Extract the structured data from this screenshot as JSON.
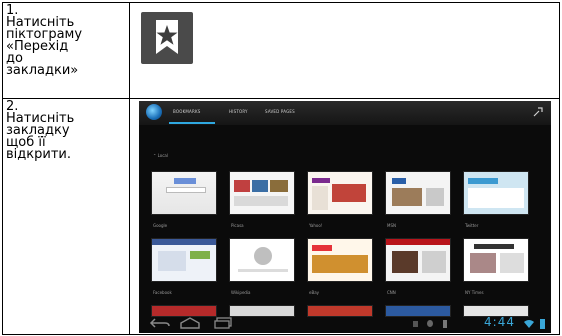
{
  "steps": [
    {
      "text": "1.\nНатисніть\nпіктограму\n«Перехід\nдо\nзакладки»"
    },
    {
      "text": "2.\nНатисніть\nзакладку\nщоб її\nвідкрити."
    }
  ],
  "screen": {
    "tabs": [
      "BOOKMARKS",
      "HISTORY",
      "SAVED PAGES"
    ],
    "section": "Local",
    "bookmarks": [
      "Google",
      "Picasa",
      "Yahoo!",
      "MSN",
      "Twitter",
      "Facebook",
      "Wikipedia",
      "eBay",
      "CNN",
      "NY Times"
    ],
    "time": "4:44",
    "accent": "#2fa8e0"
  },
  "icons": [
    "bookmark-star-icon",
    "globe-icon",
    "add-bookmark-icon",
    "back-icon",
    "home-icon",
    "recent-apps-icon"
  ]
}
